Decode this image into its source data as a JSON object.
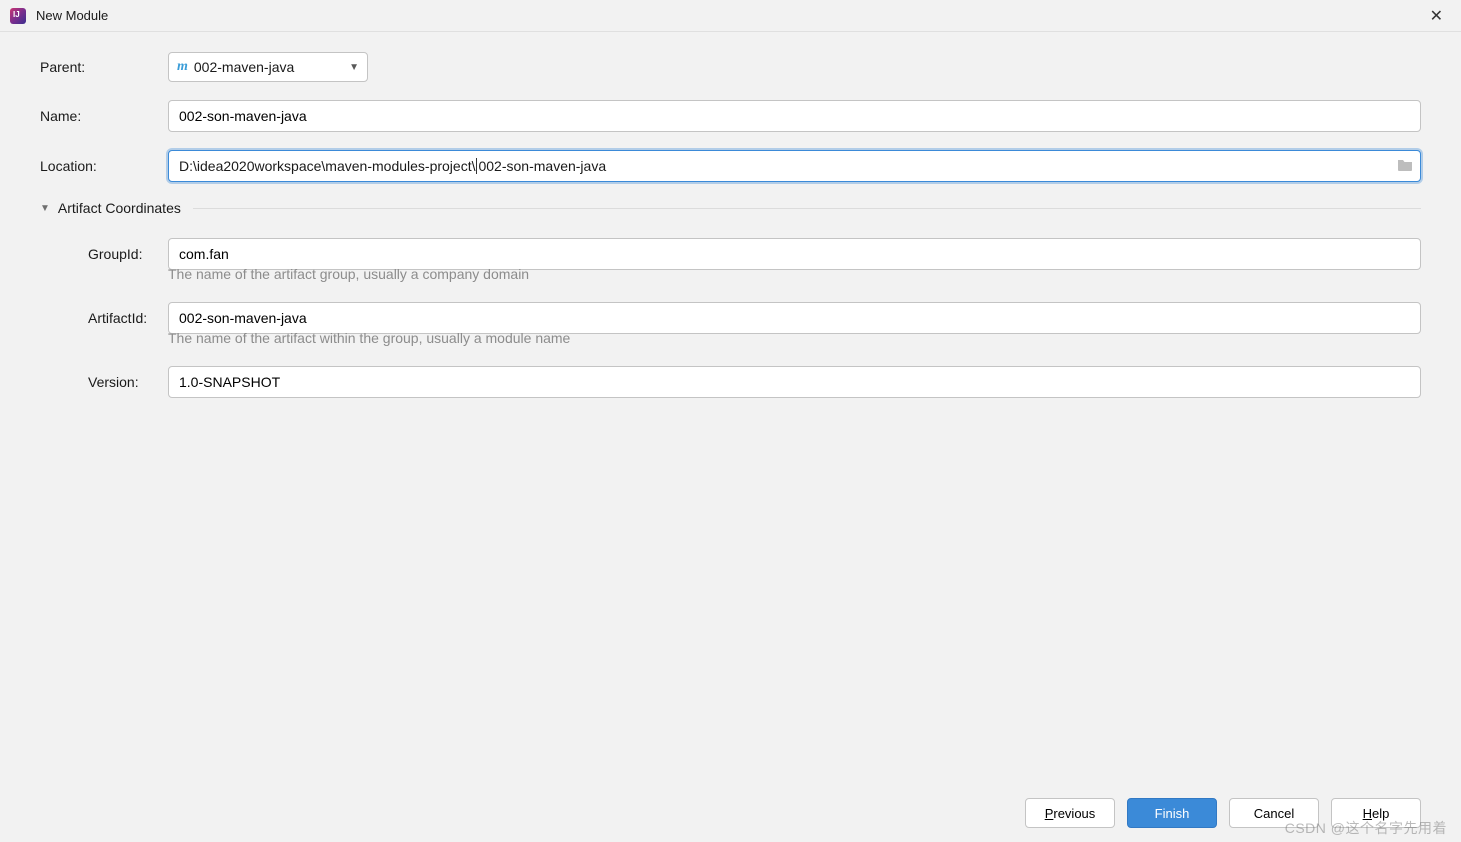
{
  "window": {
    "title": "New Module"
  },
  "form": {
    "parent_label": "Parent:",
    "parent_value": "002-maven-java",
    "name_label": "Name:",
    "name_value": "002-son-maven-java",
    "location_label": "Location:",
    "location_prefix": "D:\\idea2020workspace\\maven-modules-project\\",
    "location_suffix": "002-son-maven-java"
  },
  "artifact": {
    "section_title": "Artifact Coordinates",
    "groupid_label": "GroupId:",
    "groupid_value": "com.fan",
    "groupid_hint": "The name of the artifact group, usually a company domain",
    "artifactid_label": "ArtifactId:",
    "artifactid_value": "002-son-maven-java",
    "artifactid_hint": "The name of the artifact within the group, usually a module name",
    "version_label": "Version:",
    "version_value": "1.0-SNAPSHOT"
  },
  "footer": {
    "previous": "Previous",
    "finish": "Finish",
    "cancel": "Cancel",
    "help": "Help"
  },
  "watermark": "CSDN @这个名字先用着"
}
